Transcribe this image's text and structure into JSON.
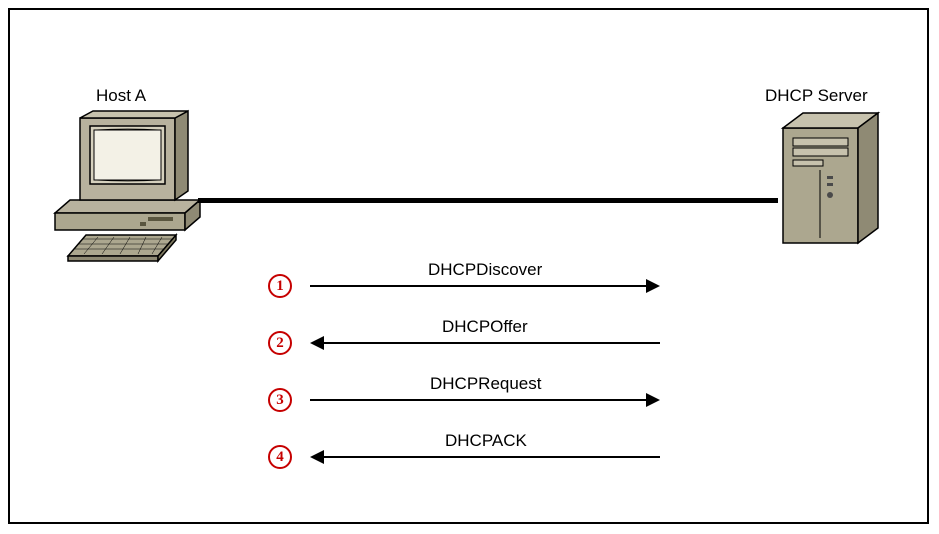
{
  "diagram": {
    "host_label": "Host A",
    "server_label": "DHCP Server",
    "steps": [
      {
        "num": "1",
        "text": "DHCPDiscover",
        "dir": "right"
      },
      {
        "num": "2",
        "text": "DHCPOffer",
        "dir": "left"
      },
      {
        "num": "3",
        "text": "DHCPRequest",
        "dir": "right"
      },
      {
        "num": "4",
        "text": "DHCPACK",
        "dir": "left"
      }
    ]
  }
}
